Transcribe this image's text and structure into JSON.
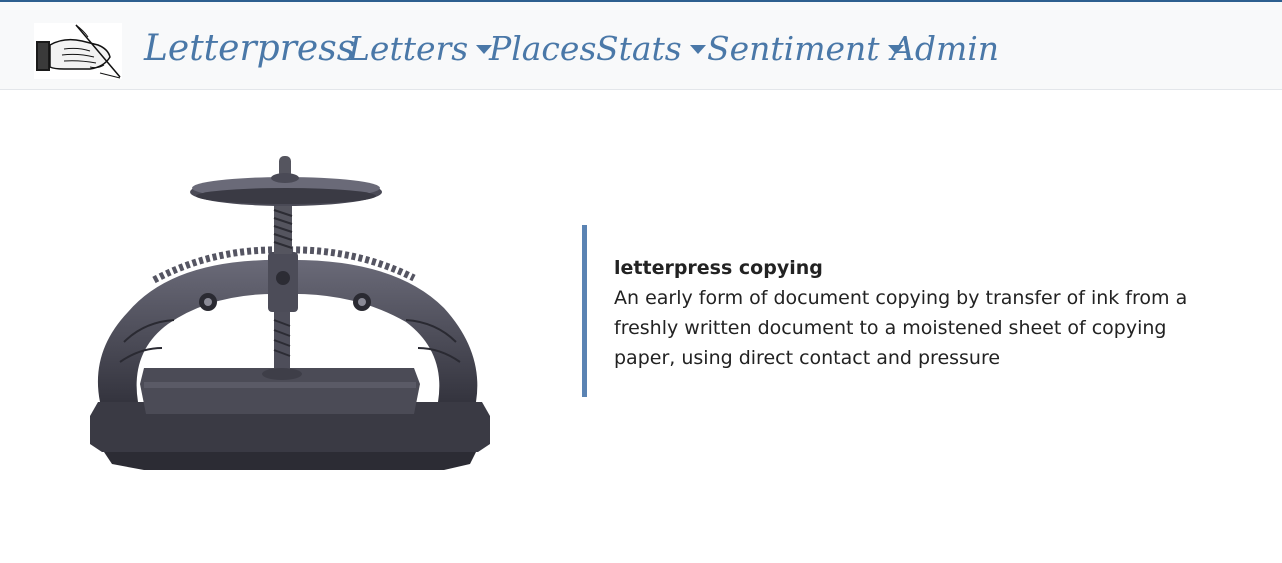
{
  "navbar": {
    "logo_icon": "hand-writing-with-quill-icon",
    "brand": "Letterpress",
    "items": [
      {
        "label": "Letters",
        "dropdown": true
      },
      {
        "label": "Places",
        "dropdown": false
      },
      {
        "label": "Stats",
        "dropdown": true
      },
      {
        "label": "Sentiment",
        "dropdown": true
      },
      {
        "label": "Admin",
        "dropdown": false
      }
    ]
  },
  "main": {
    "image": "cast-iron-copying-press",
    "definition": {
      "term": "letterpress copying",
      "body": "An early form of document copying by transfer of ink from a freshly written document to a moistened sheet of copying paper, using direct contact and pressure"
    }
  },
  "colors": {
    "accent": "#4a78a8",
    "top_border": "#2d5f8f",
    "quote_border": "#5a83b3",
    "navbar_bg": "#f8f9fa"
  }
}
